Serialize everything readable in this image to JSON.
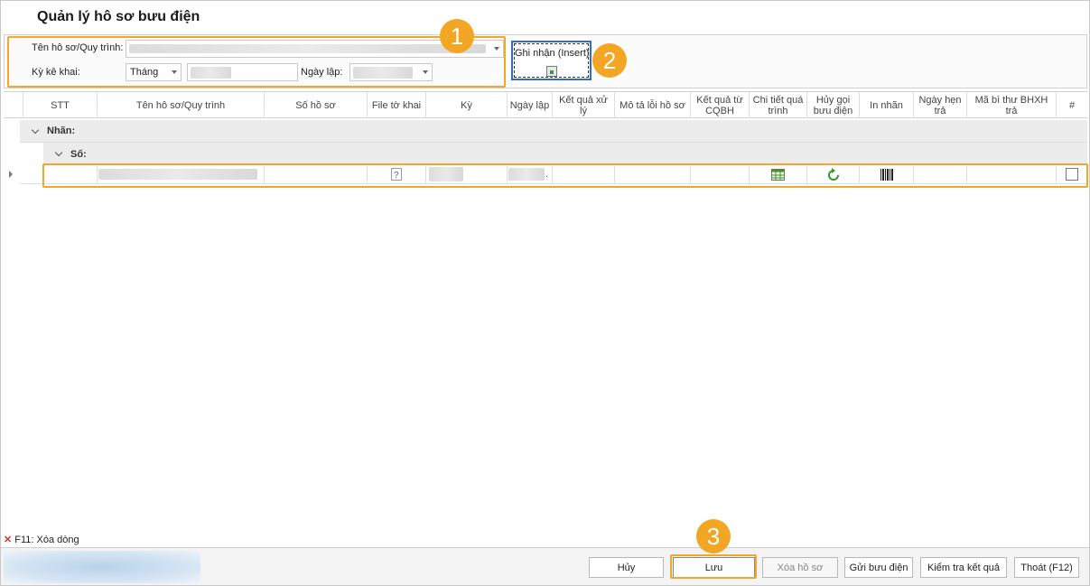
{
  "title": "Quản lý hô sơ bưu điện",
  "filters": {
    "record_label": "Tên hô sơ/Quy trình:",
    "period_label": "Kỳ kê khai:",
    "period_type": "Tháng",
    "date_label": "Ngày lập:"
  },
  "insert_button": {
    "label": "Ghi nhận (Insert)"
  },
  "badges": [
    "1",
    "2",
    "3"
  ],
  "columns": [
    "STT",
    "Tên hô sơ/Quy trình",
    "Số hồ sơ",
    "File tờ khai",
    "Kỳ",
    "Ngày lập",
    "Kết quả xử lý",
    "Mô tả lỗi hồ sơ",
    "Kết quả từ CQBH",
    "Chi tiết quá trình",
    "Hủy gọi bưu điện",
    "In nhãn",
    "Ngày hẹn trả",
    "Mã bì thư BHXH trả",
    "#"
  ],
  "groups": {
    "label_group": "Nhãn:",
    "number_group": "Số:"
  },
  "row": {
    "ky_suffix": "."
  },
  "footer": {
    "hint": "F11: Xóa dòng",
    "buttons": {
      "cancel": "Hủy",
      "save": "Lưu",
      "delete": "Xóa hồ sơ",
      "send": "Gửi bưu điện",
      "check": "Kiểm tra kết quả",
      "exit": "Thoát (F12)"
    }
  },
  "colors": {
    "highlight": "#f0a72a",
    "badge": "#f2a623",
    "accent": "#2e6cc5"
  }
}
